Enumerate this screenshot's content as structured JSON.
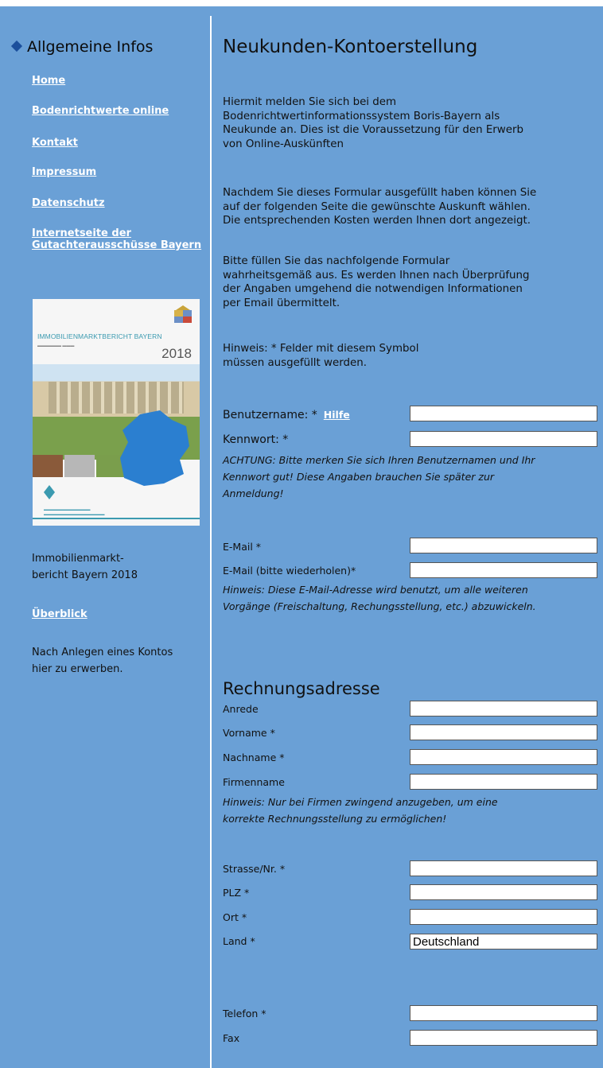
{
  "sidebar": {
    "heading": "Allgemeine Infos",
    "links": [
      {
        "label": "Home"
      },
      {
        "label": "Bodenrichtwerte online"
      },
      {
        "label": "Kontakt"
      },
      {
        "label": "Impressum"
      },
      {
        "label": "Datenschutz"
      },
      {
        "label_line1": "Internetseite der",
        "label_line2": "Gutachterausschüsse Bayern"
      }
    ],
    "cover": {
      "title": "IMMOBILIENMARKTBERICHT BAYERN",
      "year": "2018"
    },
    "caption_line1": "Immobilienmarkt-",
    "caption_line2": "bericht Bayern 2018",
    "overview_link": "Überblick",
    "note_line1": "Nach Anlegen eines Kontos",
    "note_line2": "hier zu erwerben."
  },
  "main": {
    "title": "Neukunden-Kontoerstellung",
    "intro": [
      "Hiermit melden Sie sich bei dem",
      "Bodenrichtwertinformationssystem Boris-Bayern als",
      "Neukunde an. Dies ist die Voraussetzung für den Erwerb",
      "von Online-Auskünften"
    ],
    "para2": [
      "Nachdem Sie dieses Formular ausgefüllt haben können Sie",
      "auf der folgenden Seite die gewünschte Auskunft wählen.",
      "Die entsprechenden Kosten werden Ihnen dort angezeigt."
    ],
    "para3": [
      "Bitte füllen Sie das nachfolgende Formular",
      "wahrheitsgemäß aus. Es werden Ihnen nach Überprüfung",
      "der Angaben umgehend die notwendigen Informationen",
      "per Email übermittelt."
    ],
    "hint": [
      "Hinweis: * Felder mit diesem Symbol",
      "müssen ausgefüllt werden."
    ],
    "account": {
      "username_label": "Benutzername: *",
      "help_link": "Hilfe",
      "password_label": "Kennwort: *",
      "warning": [
        "ACHTUNG: Bitte merken Sie sich Ihren Benutzernamen und Ihr",
        "Kennwort gut! Diese Angaben brauchen Sie später zur",
        "Anmeldung!"
      ],
      "email_label": "E-Mail *",
      "email_repeat_label": "E-Mail (bitte wiederholen)*",
      "email_note": [
        "Hinweis: Diese E-Mail-Adresse wird benutzt, um alle weiteren",
        "Vorgänge (Freischaltung, Rechungsstellung, etc.) abzuwickeln."
      ]
    },
    "billing": {
      "title": "Rechnungsadresse",
      "anrede_label": "Anrede",
      "vorname_label": "Vorname *",
      "nachname_label": "Nachname *",
      "firma_label": "Firmenname",
      "firma_note": [
        "Hinweis: Nur bei Firmen zwingend anzugeben, um eine",
        "korrekte Rechnungsstellung zu ermöglichen!"
      ],
      "strasse_label": "Strasse/Nr. *",
      "plz_label": "PLZ *",
      "ort_label": "Ort *",
      "land_label": "Land *",
      "land_value": "Deutschland",
      "telefon_label": "Telefon *",
      "fax_label": "Fax"
    }
  }
}
